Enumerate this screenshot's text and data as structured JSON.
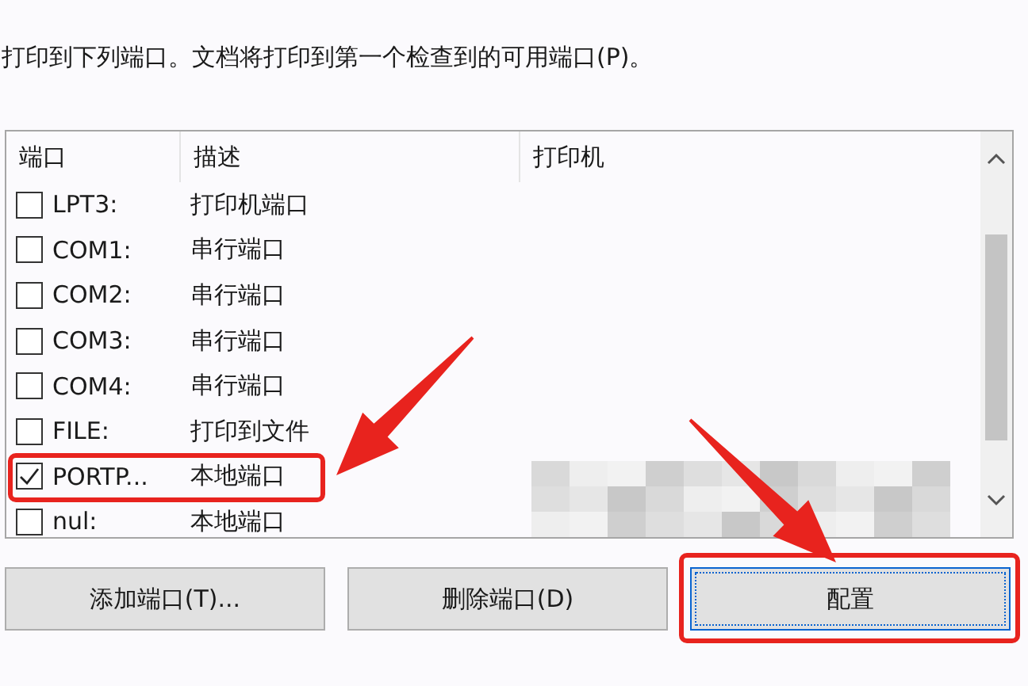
{
  "instruction": "打印到下列端口。文档将打印到第一个检查到的可用端口(P)。",
  "port_list": {
    "columns": [
      "端口",
      "描述",
      "打印机"
    ],
    "rows": [
      {
        "port": "LPT3:",
        "description": "打印机端口",
        "checked": false,
        "redacted": false,
        "highlighted": false
      },
      {
        "port": "COM1:",
        "description": "串行端口",
        "checked": false,
        "redacted": false,
        "highlighted": false
      },
      {
        "port": "COM2:",
        "description": "串行端口",
        "checked": false,
        "redacted": false,
        "highlighted": false
      },
      {
        "port": "COM3:",
        "description": "串行端口",
        "checked": false,
        "redacted": false,
        "highlighted": false
      },
      {
        "port": "COM4:",
        "description": "串行端口",
        "checked": false,
        "redacted": false,
        "highlighted": false
      },
      {
        "port": "FILE:",
        "description": "打印到文件",
        "checked": false,
        "redacted": false,
        "highlighted": false
      },
      {
        "port": "PORTP...",
        "description": "本地端口",
        "checked": true,
        "redacted": true,
        "highlighted": true
      },
      {
        "port": "nul:",
        "description": "本地端口",
        "checked": false,
        "redacted": false,
        "highlighted": false
      }
    ]
  },
  "buttons": [
    {
      "label": "添加端口(T)...",
      "focused": false,
      "highlighted": false
    },
    {
      "label": "删除端口(D)",
      "focused": false,
      "highlighted": false
    },
    {
      "label": "配置",
      "focused": true,
      "highlighted": true
    }
  ]
}
